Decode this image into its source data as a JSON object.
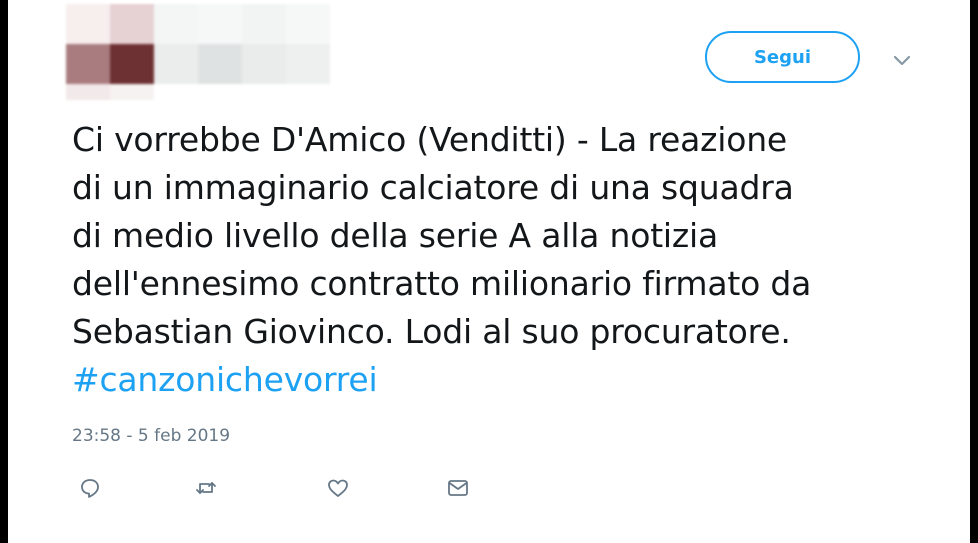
{
  "header": {
    "follow_label": "Segui"
  },
  "tweet": {
    "lines": [
      "Ci vorrebbe D'Amico (Venditti) - La reazione",
      "di un immaginario calciatore di una squadra",
      "di medio livello della serie A alla notizia",
      "dell'ennesimo contratto milionario firmato da",
      "Sebastian Giovinco. Lodi al suo procuratore."
    ],
    "hashtag": "#canzonichevorrei",
    "timestamp": "23:58 - 5 feb 2019"
  },
  "actions": {
    "icons": [
      "reply-icon",
      "retweet-icon",
      "like-icon",
      "direct-message-icon"
    ]
  },
  "colors": {
    "accent": "#1da1f2",
    "text": "#14171a",
    "muted": "#657786"
  }
}
